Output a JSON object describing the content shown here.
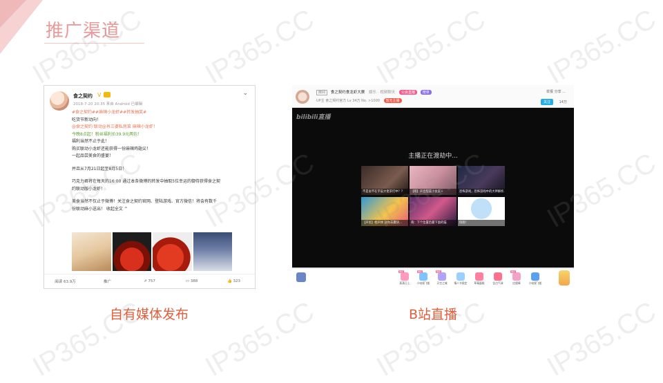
{
  "page": {
    "title": "推广渠道",
    "accent_color": "#e99b9b",
    "caption_color": "#e35d3a"
  },
  "watermark": "IP365.CC",
  "left_panel": {
    "caption": "自有媒体发布",
    "post": {
      "username": "食之契约",
      "meta": "2018-7-20 20:35 来自 Android  已编辑",
      "lines": [
        "#食之契约##麻辣小龙虾##转发抽奖#",
        "吃货节新动向！",
        "@食之契约 联动@肖三婆私房菜 麻辣小龙虾！",
        "今晚8点起！粉丝福利价39.9元两包！",
        "福利当然不止于此！",
        "购买联动小龙虾还能获得一份麻辣鸡翅尖！",
        "一起品尝美食的盛宴！",
        "",
        "并且从7月21日起至8月5日！",
        "",
        "巧克力君将在每天的16:00 通过本条微博的转发中抽取5位幸运的御侍获得食之契",
        "约联动版小龙虾！",
        "",
        "美食当然不仅止于微博！关注食之契约官网、登陆游戏、官方微信！将会有数千",
        "份联动麻小送出！ 收起全文 ^"
      ],
      "footer": {
        "reads": "阅读 63.9万",
        "promote": "推广",
        "reposts": "757",
        "comments": "388",
        "likes": "323"
      }
    }
  },
  "right_panel": {
    "caption": "B站直播",
    "room": {
      "badge": "房间",
      "title": "食之契约食龙虾大赛",
      "extra": "娱乐 · 视频聊天",
      "tag1": "公会直播",
      "tag2": "榜单",
      "sub": "UP主 食之契约官方   Lv   34万   No. >1000",
      "sub_tag": "暂无主播",
      "share": "举报  分享  ...",
      "follow": "关注",
      "fans": "14万"
    },
    "player": {
      "logo": "bilibili直播",
      "status": "主播正在渡劫中...",
      "recommendations": [
        "不是说不在宇宙大佬求打中？？",
        "【萌】声音甜美小女友~",
        "恐怖游戏，恐怖游戏中的大神解析...",
        "【声优】相声体 送你去赢快...",
        "萌：下个位置后最下面的猫",
        "快跑！"
      ]
    },
    "gifts": [
      "蒸蒸日上",
      "小电视飞船",
      "天空之城",
      "情人节限定",
      "草莓蛋糕",
      "告白气球",
      "应援棒",
      "小电视飞船"
    ]
  }
}
